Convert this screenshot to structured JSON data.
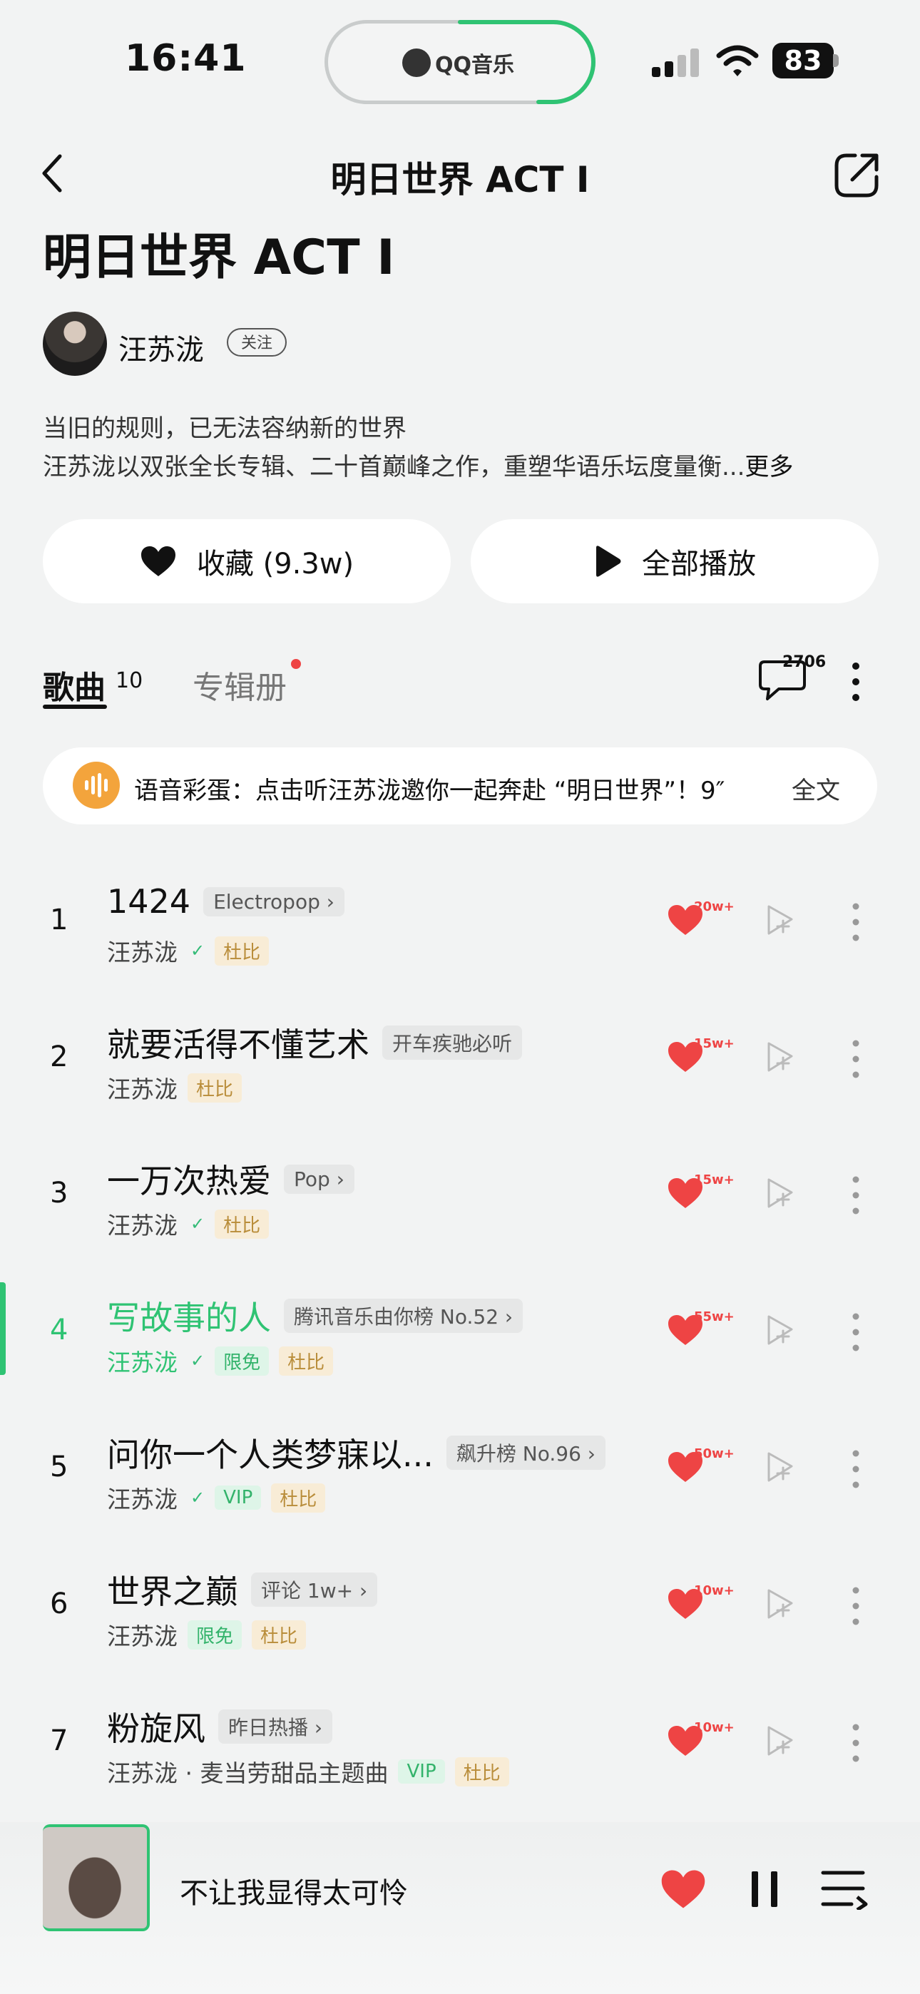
{
  "status_bar": {
    "time": "16:41",
    "app_indicator": "QQ音乐",
    "battery": "83"
  },
  "nav": {
    "title": "明日世界 ACT I"
  },
  "album": {
    "title": "明日世界 ACT I",
    "artist": "汪苏泷",
    "follow_label": "关注",
    "description_line1": "当旧的规则，已无法容纳新的世界",
    "description_line2": "汪苏泷以双张全长专辑、二十首巅峰之作，重塑华语乐坛度量衡...",
    "description_more": "更多"
  },
  "actions": {
    "collect_label": "收藏 (9.3w)",
    "play_all_label": "全部播放"
  },
  "tabs": {
    "songs_label": "歌曲",
    "songs_count": "10",
    "booklet_label": "专辑册",
    "comment_count": "2706"
  },
  "voice_banner": {
    "text": "语音彩蛋：点击听汪苏泷邀你一起奔赴 “明日世界”！9″",
    "full_label": "全文"
  },
  "songs": [
    {
      "num": "1",
      "title": "1424",
      "tag": "Electropop ›",
      "artist": "汪苏泷",
      "likes": "20w+"
    },
    {
      "num": "2",
      "title": "就要活得不懂艺术",
      "tag": "开车疾驰必听",
      "artist": "汪苏泷",
      "likes": "15w+"
    },
    {
      "num": "3",
      "title": "一万次热爱",
      "tag": "Pop ›",
      "artist": "汪苏泷",
      "likes": "15w+"
    },
    {
      "num": "4",
      "title": "写故事的人",
      "tag": "腾讯音乐由你榜 No.52 ›",
      "artist": "汪苏泷",
      "badge": "限免",
      "likes": "55w+"
    },
    {
      "num": "5",
      "title": "问你一个人类梦寐以...",
      "tag": "飙升榜 No.96 ›",
      "artist": "汪苏泷",
      "badge": "VIP",
      "likes": "50w+"
    },
    {
      "num": "6",
      "title": "世界之巅",
      "tag": "评论 1w+ ›",
      "artist": "汪苏泷",
      "badge": "限免",
      "likes": "10w+"
    },
    {
      "num": "7",
      "title": "粉旋风",
      "tag": "昨日热播 ›",
      "artist": "汪苏泷 · 麦当劳甜品主题曲",
      "badge": "VIP",
      "likes": "10w+"
    }
  ],
  "dolby_label": "杜比",
  "player": {
    "song": "不让我显得太可怜"
  },
  "colors": {
    "accent_green": "#2fc373",
    "heart_red": "#ee4444"
  }
}
